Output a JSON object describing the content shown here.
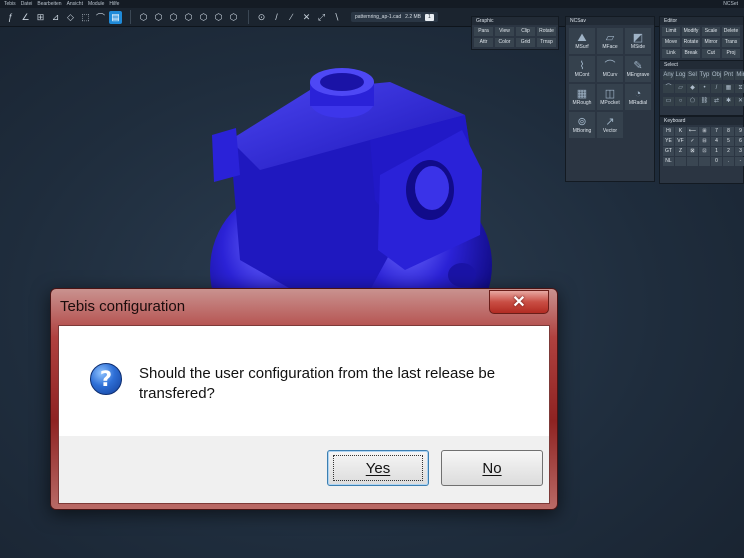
{
  "menu": {
    "items": [
      "Tebis",
      "Datei",
      "Bearbeiten",
      "Ansicht",
      "Module",
      "Hilfe"
    ],
    "right_label": "NCSet"
  },
  "toolbar": {
    "tool_icons": [
      "ƒ",
      "∠",
      "⊞",
      "⊿",
      "◇",
      "⬚",
      "⌒",
      "▤"
    ],
    "view_icons": [
      "⬡",
      "⬡",
      "⬡",
      "⬡",
      "⬡",
      "⬡",
      "⬡"
    ],
    "draw_icons": [
      "⊙",
      "/",
      "∕",
      "✕",
      "⤢",
      "∖"
    ],
    "file_name": "patternring_ap-1.cad",
    "file_size": "2.2 MB",
    "file_count": "1"
  },
  "panels": {
    "graphic": {
      "title": "Graphic",
      "buttons": [
        "Para",
        "View",
        "Clip",
        "Rotate",
        "Attr",
        "Color",
        "Grid",
        "Trnsp"
      ]
    },
    "ncsav": {
      "title": "NCSav",
      "buttons": [
        "MSurf",
        "MFace",
        "MSide",
        "MCont",
        "MCurv",
        "MEngrave",
        "MRough",
        "MPocket",
        "MRadial",
        "MBoring",
        "Vector"
      ]
    },
    "editor": {
      "title": "Editor",
      "buttons": [
        "Limit",
        "Modify",
        "Scale",
        "Delete",
        "Move",
        "Rotate",
        "Mirror",
        "Trans",
        "Link",
        "Break",
        "Cut",
        "Proj"
      ]
    },
    "select": {
      "title": "Select",
      "tabs": [
        "Any",
        "Log",
        "Sel",
        "Typ",
        "Obj",
        "Pnt",
        "Mir"
      ]
    },
    "keyboard": {
      "title": "Keyboard",
      "keys": [
        "Hi",
        "K",
        "⟵",
        "⊞",
        "7",
        "8",
        "9",
        "YE",
        "VF",
        "✓",
        "⊟",
        "4",
        "5",
        "6",
        "GT",
        "Z",
        "⊠",
        "⊡",
        "1",
        "2",
        "3",
        "NL",
        "",
        "",
        "",
        "0",
        ".",
        "-"
      ]
    }
  },
  "dialog": {
    "title": "Tebis configuration",
    "close_label": "✕",
    "icon": "question-icon",
    "message": "Should the user configuration from the last release be transfered?",
    "yes_label": "Yes",
    "no_label": "No"
  },
  "colors": {
    "part": "#2b22d6",
    "accent": "#1f8ad8",
    "dialog_frame": "#a8312f"
  }
}
